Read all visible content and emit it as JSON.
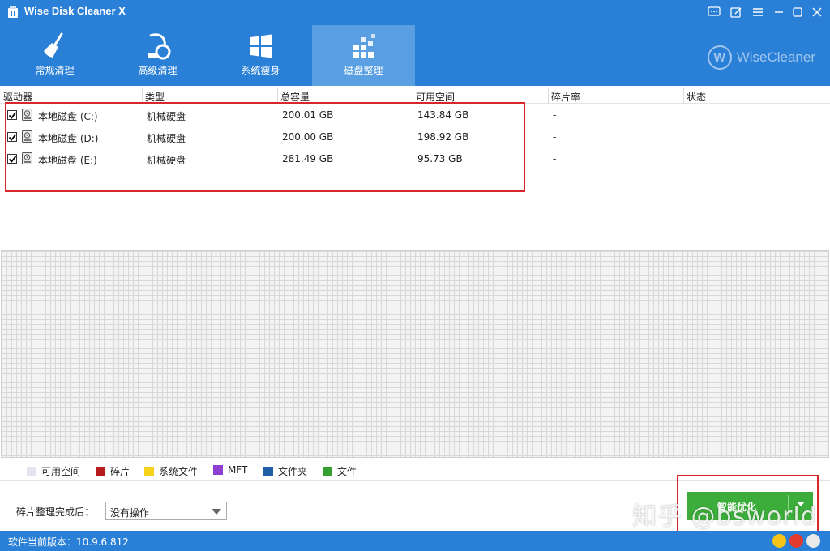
{
  "window": {
    "title": "Wise Disk Cleaner X",
    "controls": [
      "feedback",
      "skin",
      "menu",
      "minimize",
      "maximize",
      "close"
    ]
  },
  "tabs": [
    {
      "label": "常规清理",
      "icon": "broom-icon",
      "active": false
    },
    {
      "label": "高级清理",
      "icon": "vacuum-icon",
      "active": false
    },
    {
      "label": "系统瘦身",
      "icon": "windows-icon",
      "active": false
    },
    {
      "label": "磁盘整理",
      "icon": "defrag-blocks-icon",
      "active": true
    }
  ],
  "brand": {
    "logo_letter": "W",
    "name": "WiseCleaner"
  },
  "table": {
    "columns": [
      "驱动器",
      "类型",
      "总容量",
      "可用空间",
      "碎片率",
      "状态"
    ],
    "rows": [
      {
        "checked": true,
        "drive": "本地磁盘 (C:)",
        "type": "机械硬盘",
        "total": "200.01 GB",
        "free": "143.84 GB",
        "frag": "-",
        "status": ""
      },
      {
        "checked": true,
        "drive": "本地磁盘 (D:)",
        "type": "机械硬盘",
        "total": "200.00 GB",
        "free": "198.92 GB",
        "frag": "-",
        "status": ""
      },
      {
        "checked": true,
        "drive": "本地磁盘 (E:)",
        "type": "机械硬盘",
        "total": "281.49 GB",
        "free": "95.73 GB",
        "frag": "-",
        "status": ""
      }
    ]
  },
  "legend": [
    {
      "label": "可用空间",
      "color": "#e3e6ef"
    },
    {
      "label": "碎片",
      "color": "#b71c1c"
    },
    {
      "label": "系统文件",
      "color": "#f6d21a"
    },
    {
      "label": "MFT",
      "color": "#8e3fd1"
    },
    {
      "label": "文件夹",
      "color": "#1f5fa8"
    },
    {
      "label": "文件",
      "color": "#34a02f"
    }
  ],
  "after_defrag": {
    "label": "碎片整理完成后：",
    "selected": "没有操作"
  },
  "start_button": {
    "label": "智能优化"
  },
  "watermark": "知乎 @bsworld",
  "status": {
    "version": "软件当前版本：10.9.6.812"
  },
  "colors": {
    "accent": "#2a7fd6",
    "tab_active": "#5a9fe2",
    "button_green": "#3cad3a",
    "highlight_red": "#d9262c"
  }
}
